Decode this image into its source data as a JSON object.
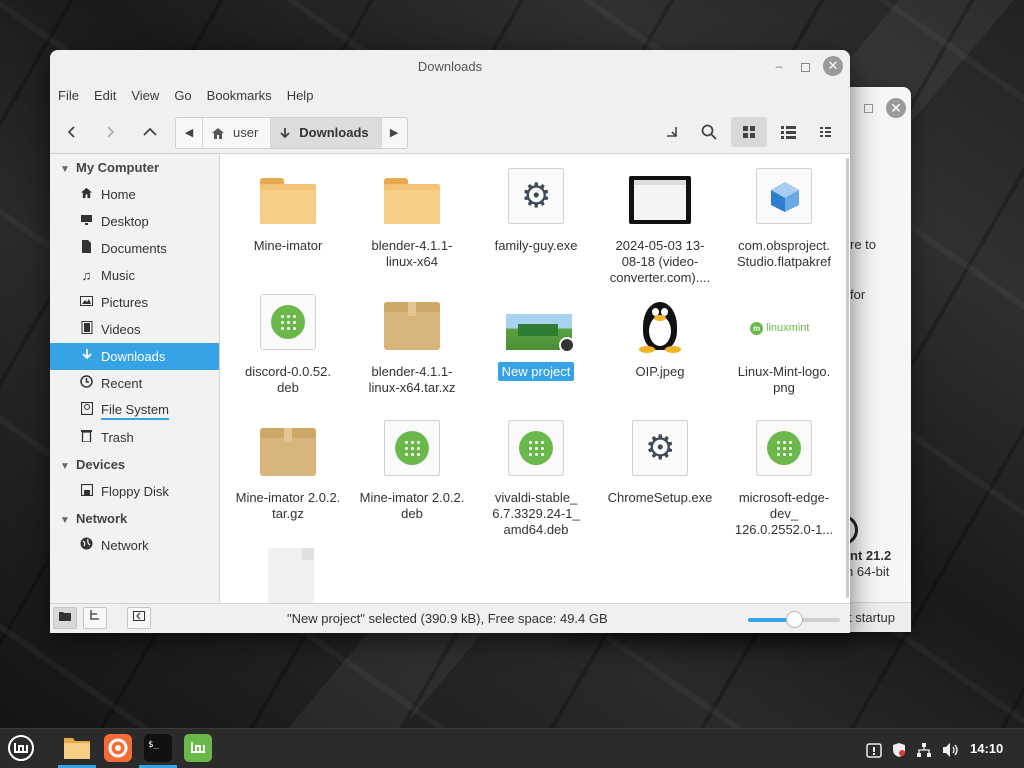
{
  "colors": {
    "accent": "#35a3e5",
    "folder": "#f3c478",
    "package_green": "#6ab74a",
    "taskbar": "#2b2b2b"
  },
  "background_window": {
    "text_lines": [
      "re to",
      "for",
      "nt 21.2",
      "n 64-bit",
      "t startup"
    ]
  },
  "window": {
    "title": "Downloads",
    "minimize_glyph": "–",
    "close_glyph": "✕"
  },
  "menubar": {
    "items": [
      "File",
      "Edit",
      "View",
      "Go",
      "Bookmarks",
      "Help"
    ]
  },
  "toolbar": {
    "back_icon": "chevron-left-icon",
    "forward_icon": "chevron-right-icon",
    "up_icon": "chevron-up-icon",
    "path": [
      {
        "label": "user",
        "icon": "home-icon"
      },
      {
        "label": "Downloads",
        "icon": "download-icon"
      }
    ],
    "view_mode": "icons"
  },
  "sidebar": {
    "sections": [
      {
        "title": "My Computer",
        "items": [
          {
            "label": "Home",
            "icon": "home-icon"
          },
          {
            "label": "Desktop",
            "icon": "desktop-icon"
          },
          {
            "label": "Documents",
            "icon": "document-icon"
          },
          {
            "label": "Music",
            "icon": "music-icon"
          },
          {
            "label": "Pictures",
            "icon": "pictures-icon"
          },
          {
            "label": "Videos",
            "icon": "videos-icon"
          },
          {
            "label": "Downloads",
            "icon": "download-icon",
            "active": true
          },
          {
            "label": "Recent",
            "icon": "recent-icon"
          },
          {
            "label": "File System",
            "icon": "filesystem-icon"
          },
          {
            "label": "Trash",
            "icon": "trash-icon"
          }
        ]
      },
      {
        "title": "Devices",
        "items": [
          {
            "label": "Floppy Disk",
            "icon": "floppy-icon"
          }
        ]
      },
      {
        "title": "Network",
        "items": [
          {
            "label": "Network",
            "icon": "network-icon"
          }
        ]
      }
    ]
  },
  "files": [
    {
      "name_lines": [
        "Mine-imator"
      ],
      "type": "folder"
    },
    {
      "name_lines": [
        "blender-4.1.1-",
        "linux-x64"
      ],
      "type": "folder"
    },
    {
      "name_lines": [
        "family-guy.exe"
      ],
      "type": "exe"
    },
    {
      "name_lines": [
        "2024-05-03 13-",
        "08-18 (video-",
        "converter.com)...."
      ],
      "type": "video"
    },
    {
      "name_lines": [
        "com.obsproject.",
        "Studio.flatpakref"
      ],
      "type": "flatpak"
    },
    {
      "name_lines": [
        "discord-0.0.52.",
        "deb"
      ],
      "type": "deb"
    },
    {
      "name_lines": [
        "blender-4.1.1-",
        "linux-x64.tar.xz"
      ],
      "type": "archive"
    },
    {
      "name_lines": [
        "New project"
      ],
      "type": "project",
      "selected": true
    },
    {
      "name_lines": [
        "OIP.jpeg"
      ],
      "type": "tux"
    },
    {
      "name_lines": [
        "Linux-Mint-logo.",
        "png"
      ],
      "type": "mintlogo",
      "logo_text": "linuxmint"
    },
    {
      "name_lines": [
        "Mine-imator 2.0.2.",
        "tar.gz"
      ],
      "type": "archive"
    },
    {
      "name_lines": [
        "Mine-imator 2.0.2.",
        "deb"
      ],
      "type": "deb"
    },
    {
      "name_lines": [
        "vivaldi-stable_",
        "6.7.3329.24-1_",
        "amd64.deb"
      ],
      "type": "deb"
    },
    {
      "name_lines": [
        "ChromeSetup.exe"
      ],
      "type": "exe"
    },
    {
      "name_lines": [
        "microsoft-edge-",
        "dev_",
        "126.0.2552.0-1..."
      ],
      "type": "deb"
    },
    {
      "name_lines": [
        ""
      ],
      "type": "blank"
    }
  ],
  "statusbar": {
    "text": "\"New project\" selected (390.9 kB), Free space: 49.4 GB",
    "zoom_fraction": 0.5
  },
  "taskbar": {
    "clock": "14:10",
    "apps": [
      "mint-menu-icon",
      "files-icon",
      "firefox-icon",
      "terminal-icon",
      "mintinstall-icon"
    ],
    "tray": [
      "notification-icon",
      "shield-icon",
      "network-icon",
      "volume-icon"
    ]
  }
}
